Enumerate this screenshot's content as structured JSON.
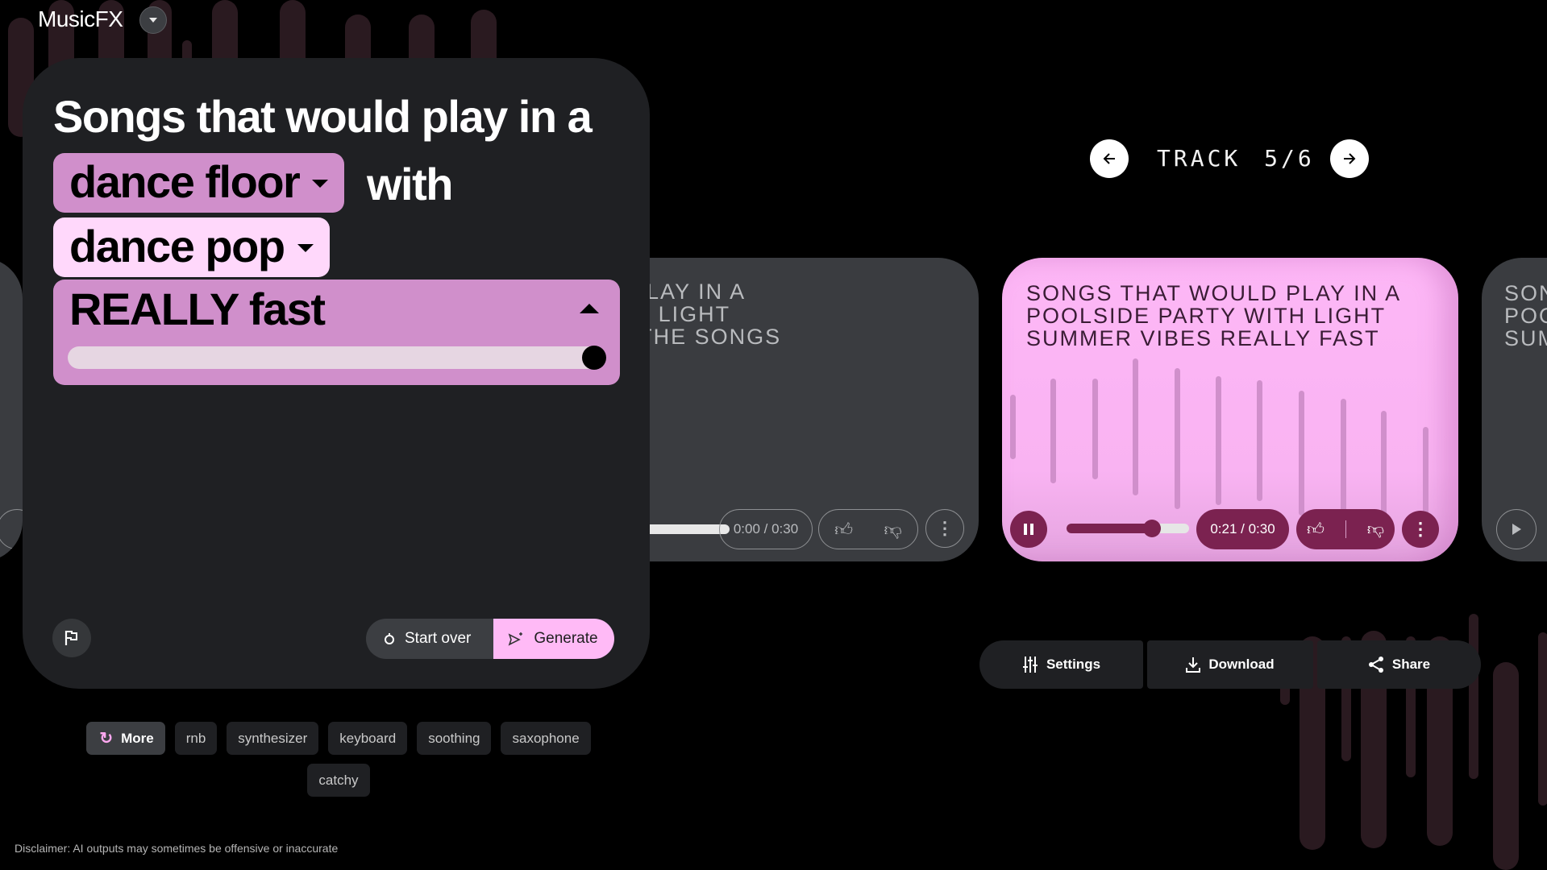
{
  "app": {
    "title": "MusicFX",
    "menu_icon": "chevron-down-icon"
  },
  "prompt": {
    "heading": "Songs that would play in a",
    "place_chip": "dance floor",
    "connector": "with",
    "genre_chip": "dance pop",
    "speed": {
      "label": "REALLY fast",
      "slider_value_fraction": 1.0
    },
    "report_icon": "flag-icon",
    "start_over_label": "Start over",
    "generate_label": "Generate"
  },
  "tags": {
    "more_label": "More",
    "items": [
      "rnb",
      "synthesizer",
      "keyboard",
      "soothing",
      "saxophone",
      "catchy"
    ]
  },
  "disclaimer": "Disclaimer: AI outputs may sometimes be offensive or inaccurate",
  "track_nav": {
    "label": "TRACK",
    "current": 5,
    "total": 6,
    "display": "5/6"
  },
  "tracks": {
    "previous": {
      "title": "SONGS THAT WOULD PLAY IN A\nPOOLSIDE PARTY WITH LIGHT\nSUMMER VIBES LOOP THE SONGS",
      "title_visible": "THAT WOULD PLAY IN A\nDE PARTY WITH LIGHT\nVIBES LOOP THE SONGS",
      "time": "0:00 / 0:30"
    },
    "active": {
      "title": "SONGS THAT WOULD PLAY IN A\nPOOLSIDE PARTY WITH LIGHT\nSUMMER VIBES REALLY FAST",
      "time": "0:21 / 0:30",
      "progress_fraction": 0.7,
      "state": "playing"
    },
    "next": {
      "title_visible": "SON\nPOO\nSUM"
    }
  },
  "actions": {
    "settings_label": "Settings",
    "download_label": "Download",
    "share_label": "Share"
  },
  "colors": {
    "accent_pink": "#ffbaf6",
    "chip_mauve": "#d08fcb",
    "chip_light": "#ffd8fb",
    "player_maroon": "#7b2250",
    "panel_bg": "#1f2023"
  }
}
